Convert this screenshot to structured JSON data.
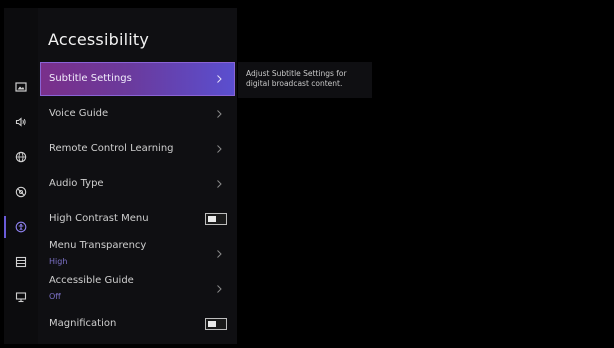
{
  "menu": {
    "title": "Accessibility",
    "items": [
      {
        "label": "Subtitle Settings",
        "type": "submenu",
        "selected": true
      },
      {
        "label": "Voice Guide",
        "type": "submenu"
      },
      {
        "label": "Remote Control Learning",
        "type": "submenu"
      },
      {
        "label": "Audio Type",
        "type": "submenu"
      },
      {
        "label": "High Contrast Menu",
        "type": "toggle",
        "on": false
      },
      {
        "label": "Menu Transparency",
        "value": "High",
        "type": "submenu"
      },
      {
        "label": "Accessible Guide",
        "value": "Off",
        "type": "submenu"
      },
      {
        "label": "Magnification",
        "type": "toggle",
        "on": false
      }
    ]
  },
  "description": {
    "text": "Adjust Subtitle Settings for digital broadcast content."
  },
  "rail": {
    "icons": [
      "picture-icon",
      "sound-icon",
      "globe-icon",
      "broadcast-icon",
      "accessibility-icon",
      "general-icon",
      "support-icon"
    ],
    "active_index": 4
  },
  "colors": {
    "accent": "#6a5bd8",
    "selected_gradient_start": "#7a2f8a",
    "selected_gradient_end": "#5a4fd0",
    "sub_value": "#7d72c9"
  }
}
